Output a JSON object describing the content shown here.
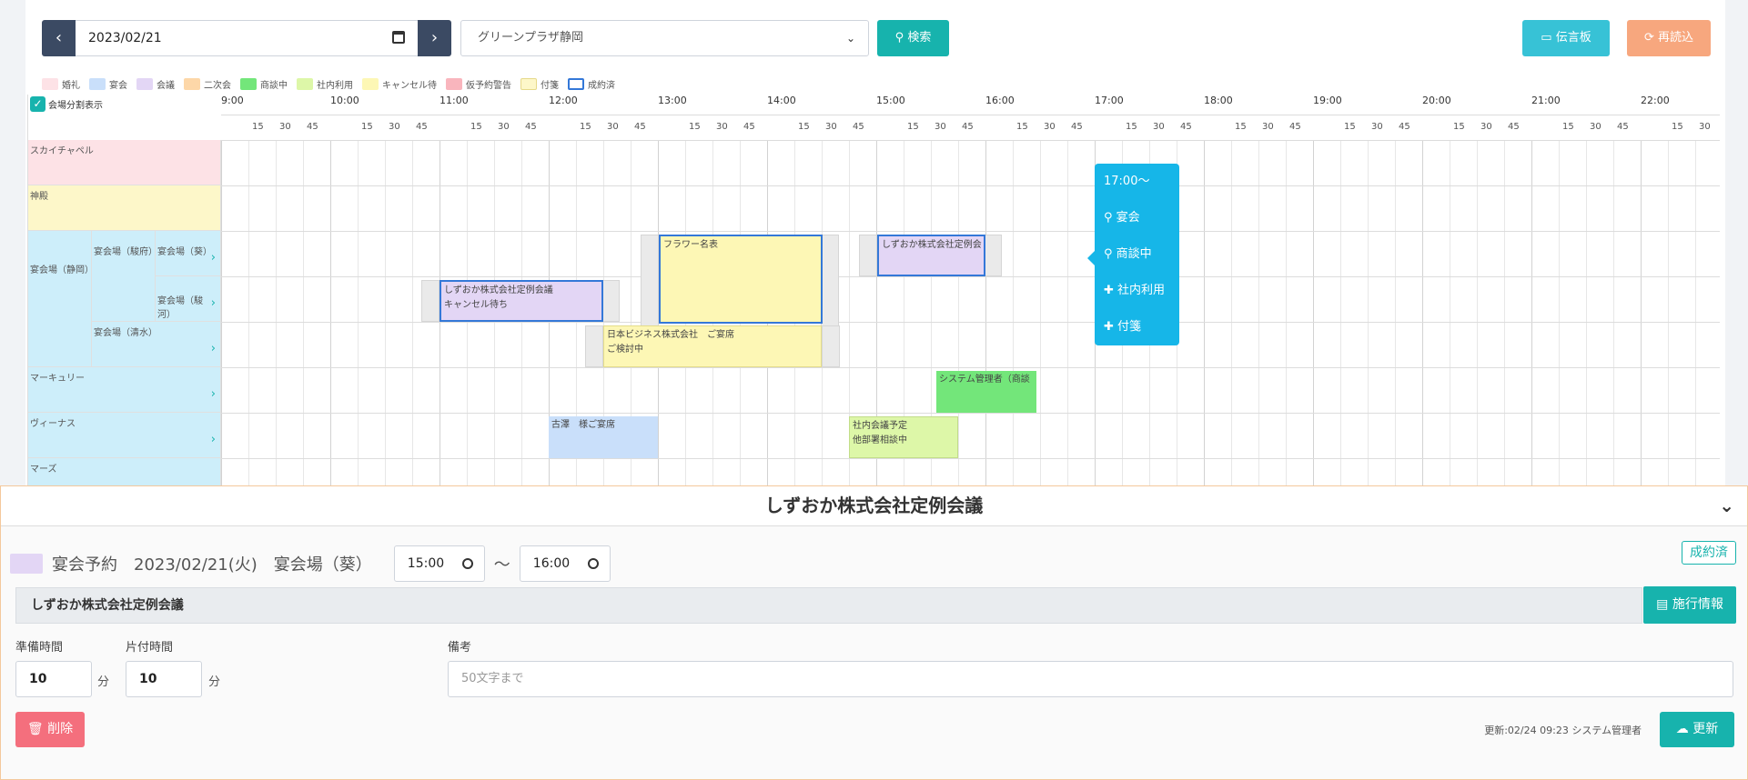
{
  "toolbar": {
    "date_value": "2023/02/21",
    "venue_value": "グリーンプラザ静岡",
    "search_label": "検索",
    "board_label": "伝言板",
    "reload_label": "再読込"
  },
  "legend": [
    {
      "label": "婚礼",
      "color": "#fde2e6"
    },
    {
      "label": "宴会",
      "color": "#c9dffa"
    },
    {
      "label": "会議",
      "color": "#e3d6f5"
    },
    {
      "label": "二次会",
      "color": "#fdd7a8"
    },
    {
      "label": "商談中",
      "color": "#73e67a"
    },
    {
      "label": "社内利用",
      "color": "#ddf7a8"
    },
    {
      "label": "キャンセル待",
      "color": "#fdf7b5"
    },
    {
      "label": "仮予約警告",
      "color": "#f9b5bd"
    },
    {
      "label": "付箋",
      "color": "#fdf7c9"
    },
    {
      "label": "成約済",
      "color": "#ffffff"
    }
  ],
  "grid": {
    "split_toggle_label": "会場分割表示",
    "hours": [
      "9:00",
      "10:00",
      "11:00",
      "12:00",
      "13:00",
      "14:00",
      "15:00",
      "16:00",
      "17:00",
      "18:00",
      "19:00",
      "20:00",
      "21:00",
      "22:00"
    ],
    "quarter_labels": [
      "15",
      "30",
      "45"
    ],
    "rooms": {
      "skychapel": "スカイチャペル",
      "shinden": "神殿",
      "banquet_hall": "宴会場（静岡）",
      "banquet_suruga_top": "宴会場（駿府）",
      "banquet_aoi": "宴会場（葵）",
      "banquet_suruga": "宴会場（駿河）",
      "banquet_shimizu": "宴会場（清水）",
      "mercury": "マーキュリー",
      "venus": "ヴィーナス",
      "mars": "マーズ"
    },
    "events": {
      "flower": "フラワー名表",
      "aoi_meeting": "しずおか株式会社定例会",
      "suruga_meeting_line1": "しずおか株式会社定例会議",
      "suruga_meeting_line2": "キャンセル待ち",
      "nihon_line1": "日本ビジネス株式会社　ご宴席",
      "nihon_line2": "ご検討中",
      "system": "システム管理者（商談",
      "furusawa": "古澤　様ご宴席",
      "internal_line1": "社内会議予定",
      "internal_line2": "他部署相談中"
    }
  },
  "popup": {
    "time_label": "17:00〜",
    "items": [
      "宴会",
      "商談中",
      "社内利用",
      "付箋"
    ]
  },
  "detail": {
    "title": "しずおか株式会社定例会議",
    "type_label": "宴会予約",
    "date_label": "2023/02/21(火)",
    "room_label": "宴会場（葵）",
    "start_time": "15:00",
    "tilde": "〜",
    "end_time": "16:00",
    "status_badge": "成約済",
    "event_name": "しずおか株式会社定例会議",
    "spec_button": "施行情報",
    "prep_label": "準備時間",
    "prep_value": "10",
    "cleanup_label": "片付時間",
    "cleanup_value": "10",
    "minute_unit": "分",
    "remarks_label": "備考",
    "remarks_placeholder": "50文字まで",
    "delete_label": "削除",
    "updated_info": "更新:02/24 09:23 システム管理者",
    "update_label": "更新"
  }
}
